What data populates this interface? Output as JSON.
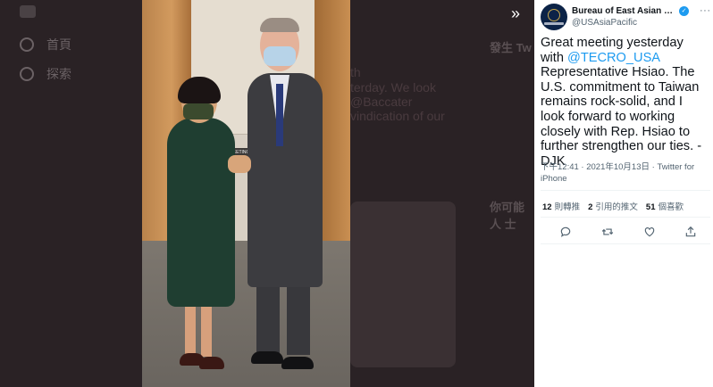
{
  "background": {
    "nav": [
      {
        "label": "首頁"
      },
      {
        "label": "探索"
      }
    ],
    "bg_texts": [
      "th",
      "terday. We look",
      "@Baccater",
      "vindication of our"
    ],
    "right_heads": [
      "發生 Tw",
      "你可能 人 士"
    ]
  },
  "photo": {
    "door_sign": "MEETING"
  },
  "tweet": {
    "author": {
      "display_name": "Bureau of East Asian and …",
      "handle": "@USAsiaPacific",
      "verified": true
    },
    "more_label": "···",
    "text_parts": [
      {
        "text": "Great meeting yesterday with ",
        "mention": false
      },
      {
        "text": "@TECRO_USA",
        "mention": true
      },
      {
        "text": " Representative Hsiao. The U.S. commitment to Taiwan remains rock-solid, and I look forward to working closely with Rep. Hsiao to further strengthen our ties. -DJK",
        "mention": false
      }
    ],
    "timestamp": "下午12:41 · 2021年10月13日 · ",
    "source": "Twitter for iPhone",
    "stats": [
      {
        "count": "12",
        "label": "則轉推"
      },
      {
        "count": "2",
        "label": "引用的推文"
      },
      {
        "count": "51",
        "label": "個喜歡"
      }
    ],
    "actions": [
      {
        "icon": "reply-icon"
      },
      {
        "icon": "retweet-icon"
      },
      {
        "icon": "like-icon"
      },
      {
        "icon": "share-icon"
      }
    ]
  },
  "controls": {
    "expand_label": "»"
  },
  "colors": {
    "mention": "#1d9bf0",
    "verified": "#1d9bf0",
    "secondary_text": "#536471"
  }
}
